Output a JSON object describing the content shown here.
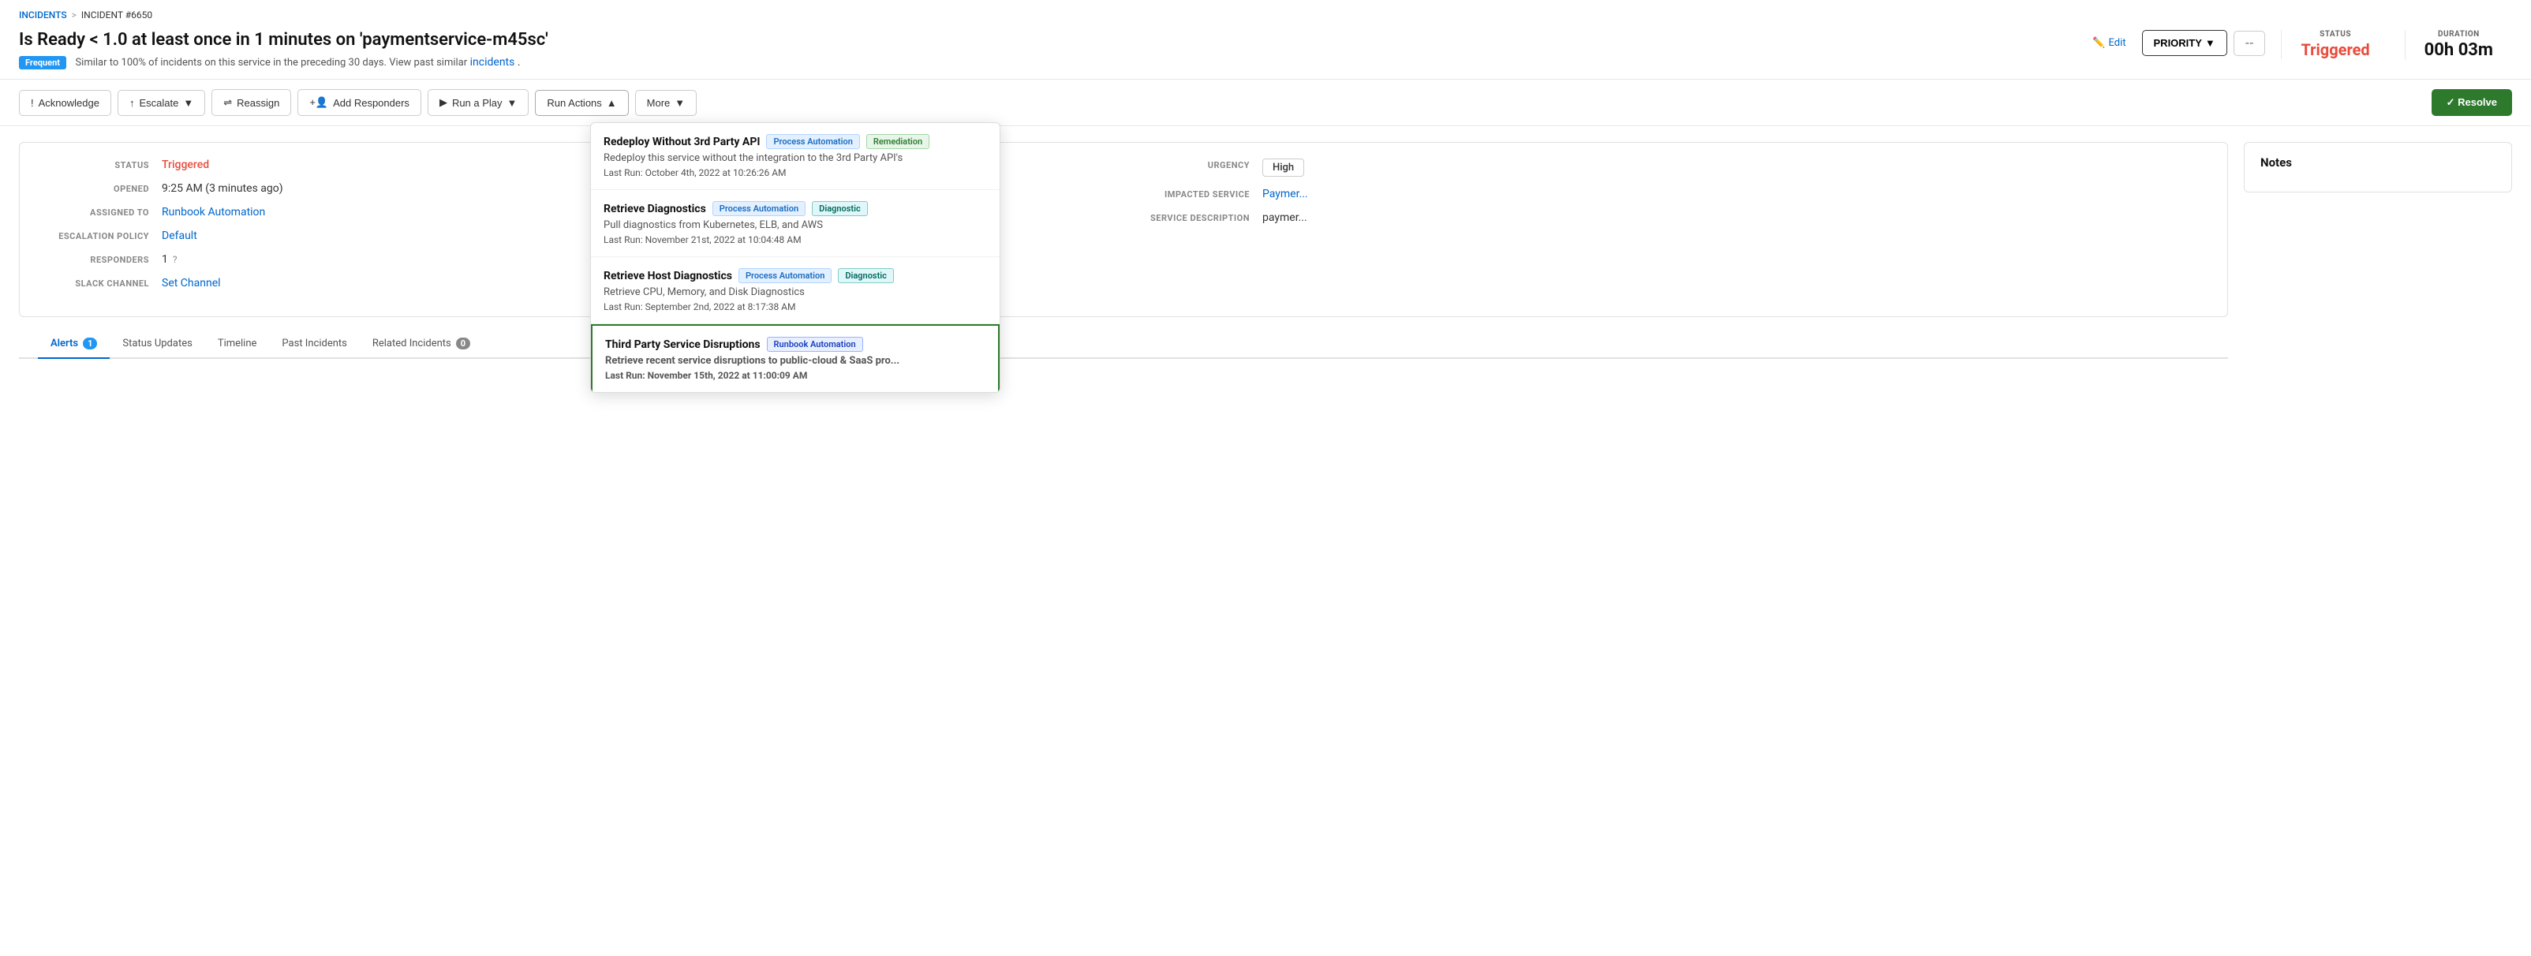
{
  "breadcrumb": {
    "incidents_label": "INCIDENTS",
    "separator": ">",
    "current": "INCIDENT #6650"
  },
  "incident": {
    "title": "Is Ready < 1.0 at least once in 1 minutes on 'paymentservice-m45sc'",
    "frequent_badge": "Frequent",
    "similar_text": "Similar to 100% of incidents on this service in the preceding 30 days. View past similar",
    "incidents_link": "incidents",
    "edit_label": "Edit",
    "priority_label": "PRIORITY",
    "priority_arrow": "▼",
    "priority_dash": "--",
    "status_label": "STATUS",
    "status_value": "Triggered",
    "duration_label": "DURATION",
    "duration_value": "00h 03m"
  },
  "toolbar": {
    "acknowledge_label": "Acknowledge",
    "acknowledge_icon": "!",
    "escalate_label": "Escalate",
    "escalate_icon": "↑",
    "reassign_label": "Reassign",
    "reassign_icon": "⇌",
    "add_responders_label": "Add Responders",
    "add_responders_icon": "+",
    "run_play_label": "Run a Play",
    "run_play_icon": "▶",
    "run_actions_label": "Run Actions",
    "run_actions_icon": "▲",
    "more_label": "More",
    "more_icon": "▼",
    "resolve_label": "✓ Resolve"
  },
  "info": {
    "status_label": "STATUS",
    "status_value": "Triggered",
    "opened_label": "OPENED",
    "opened_value": "9:25 AM (3 minutes ago)",
    "assigned_to_label": "ASSIGNED TO",
    "assigned_to_value": "Runbook Automation",
    "escalation_policy_label": "ESCALATION POLICY",
    "escalation_policy_value": "Default",
    "responders_label": "RESPONDERS",
    "responders_value": "1",
    "slack_channel_label": "SLACK CHANNEL",
    "slack_channel_value": "Set Channel",
    "urgency_label": "URGENCY",
    "urgency_value": "High",
    "impacted_service_label": "IMPACTED SERVICE",
    "impacted_service_value": "Paymer...",
    "service_description_label": "SERVICE DESCRIPTION",
    "service_description_value": "paymer..."
  },
  "tabs": {
    "alerts_label": "Alerts",
    "alerts_count": "1",
    "status_updates_label": "Status Updates",
    "timeline_label": "Timeline",
    "past_incidents_label": "Past Incidents",
    "related_incidents_label": "Related Incidents",
    "related_incidents_count": "0"
  },
  "notes": {
    "title": "Notes"
  },
  "run_actions_dropdown": {
    "items": [
      {
        "id": "redeploy",
        "title": "Redeploy Without 3rd Party API",
        "tags": [
          {
            "label": "Process Automation",
            "type": "blue"
          },
          {
            "label": "Remediation",
            "type": "green"
          }
        ],
        "description": "Redeploy this service without the integration to the 3rd Party API's",
        "last_run": "Last Run: October 4th, 2022 at 10:26:26 AM",
        "selected": false
      },
      {
        "id": "retrieve-diagnostics",
        "title": "Retrieve Diagnostics",
        "tags": [
          {
            "label": "Process Automation",
            "type": "blue"
          },
          {
            "label": "Diagnostic",
            "type": "teal"
          }
        ],
        "description": "Pull diagnostics from Kubernetes, ELB, and AWS",
        "last_run": "Last Run: November 21st, 2022 at 10:04:48 AM",
        "selected": false
      },
      {
        "id": "retrieve-host",
        "title": "Retrieve Host Diagnostics",
        "tags": [
          {
            "label": "Process Automation",
            "type": "blue"
          },
          {
            "label": "Diagnostic",
            "type": "teal"
          }
        ],
        "description": "Retrieve CPU, Memory, and Disk Diagnostics",
        "last_run": "Last Run: September 2nd, 2022 at 8:17:38 AM",
        "selected": false
      },
      {
        "id": "third-party",
        "title": "Third Party Service Disruptions",
        "tags": [
          {
            "label": "Runbook Automation",
            "type": "runbook"
          }
        ],
        "description": "Retrieve recent service disruptions to public-cloud & SaaS pro...",
        "last_run": "Last Run: November 15th, 2022 at 11:00:09 AM",
        "selected": true
      }
    ]
  }
}
